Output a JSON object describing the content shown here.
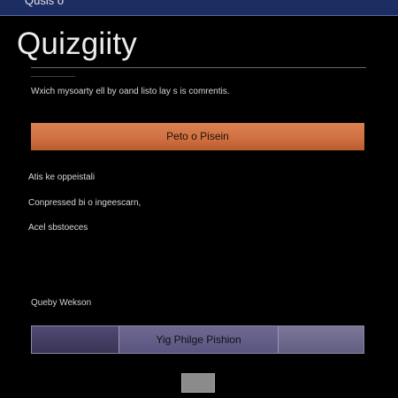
{
  "topbar": {
    "title": "Qusis o"
  },
  "header": {
    "title": "Quizgiity"
  },
  "main": {
    "description": "Wxich mysoarty ell by oand listo lay s is comrentis.",
    "primary_button_label": "Peto o Pisein",
    "options": [
      "Atis ke oppeistali",
      "Conpressed bi o ingeescarn,",
      "Acel sbstoeces"
    ],
    "section_label": "Queby Wekson",
    "segments": [
      "",
      "Yig Philge Pishion",
      ""
    ]
  },
  "colors": {
    "topbar": "#1c2d63",
    "accent": "#d0703f",
    "segment": "#5f5a86",
    "background": "#000000"
  }
}
